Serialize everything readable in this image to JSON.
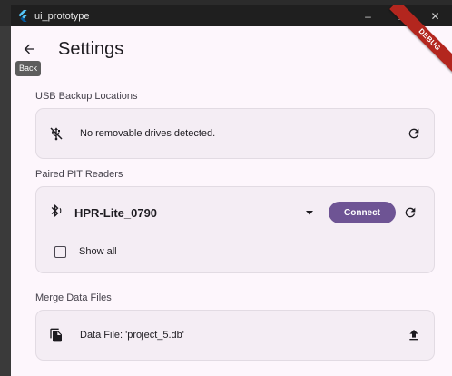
{
  "window": {
    "title": "ui_prototype",
    "controls": {
      "minimize": "–",
      "maximize": "☐",
      "close": "✕"
    }
  },
  "appbar": {
    "title": "Settings",
    "back_tooltip": "Back",
    "debug_banner": "DEBUG"
  },
  "usb_backup": {
    "section_label": "USB Backup Locations",
    "message": "No removable drives detected."
  },
  "pit_readers": {
    "section_label": "Paired PIT Readers",
    "selected_device": "HPR-Lite_0790",
    "connect_label": "Connect",
    "show_all_label": "Show all",
    "show_all_checked": false
  },
  "merge": {
    "section_label": "Merge Data Files",
    "file_text": "Data File: 'project_5.db'"
  },
  "colors": {
    "accent": "#6e5494",
    "background": "#fdf6fc",
    "card": "#f4edf4",
    "titlebar": "#1f1f1f",
    "debug_banner": "#b3261e"
  }
}
